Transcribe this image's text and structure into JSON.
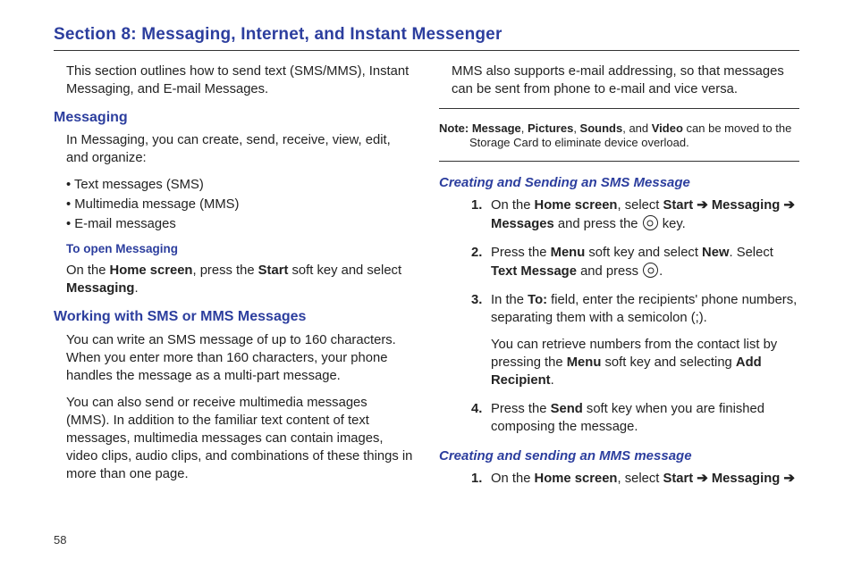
{
  "pageNumber": "58",
  "title": "Section 8: Messaging, Internet, and Instant Messenger",
  "left": {
    "intro": "This section outlines how to send text (SMS/MMS), Instant Messaging, and E-mail Messages.",
    "messaging": {
      "heading": "Messaging",
      "p1": "In Messaging, you can create, send, receive, view, edit, and organize:",
      "bullets": [
        "Text messages (SMS)",
        "Multimedia message (MMS)",
        "E-mail messages"
      ],
      "openHeading": "To open Messaging",
      "open_pre": "On the ",
      "open_b1": "Home screen",
      "open_mid1": ", press the ",
      "open_b2": "Start",
      "open_mid2": " soft key and select ",
      "open_b3": "Messaging",
      "open_post": "."
    },
    "working": {
      "heading": "Working with SMS or MMS Messages",
      "p1": "You can write an SMS message of up to 160 characters. When you enter more than 160 characters, your phone handles the message as a multi-part message.",
      "p2": "You can also send or receive multimedia messages (MMS). In addition to the familiar text content of text messages, multimedia messages can contain images, video clips, audio clips, and combinations of these things in more than one page."
    }
  },
  "right": {
    "mmsIntro": "MMS also supports e-mail addressing, so that messages can be sent from phone to e-mail and vice versa.",
    "note": {
      "label": "Note:",
      "b1": "Message",
      "c1": ", ",
      "b2": "Pictures",
      "c2": ", ",
      "b3": "Sounds",
      "c3": ", and ",
      "b4": "Video",
      "tail": " can be moved to the Storage Card to eliminate device overload."
    },
    "sms": {
      "heading": "Creating and Sending an SMS Message",
      "s1": {
        "n": "1.",
        "a": "On the ",
        "b1": "Home screen",
        "c": ", select ",
        "b2": "Start",
        "arrow1": " ➔ ",
        "b3": "Messaging",
        "arrow2": " ➔ ",
        "b4": "Messages",
        "d": " and press the ",
        "e": " key."
      },
      "s2": {
        "n": "2.",
        "a": "Press the ",
        "b1": "Menu",
        "c": " soft key and select ",
        "b2": "New",
        "d": ". Select ",
        "b3": "Text Message",
        "e": " and press ",
        "f": "."
      },
      "s3": {
        "n": "3.",
        "a": "In the ",
        "b1": "To:",
        "c": " field, enter the recipients' phone numbers, separating them with a semicolon (;).",
        "p2a": "You can retrieve numbers from the contact list by pressing the ",
        "p2b1": "Menu",
        "p2c": " soft key and selecting ",
        "p2b2": "Add Recipient",
        "p2d": "."
      },
      "s4": {
        "n": "4.",
        "a": "Press the ",
        "b1": "Send",
        "c": " soft key when you are finished composing the message."
      }
    },
    "mms": {
      "heading": "Creating and sending an MMS message",
      "s1": {
        "n": "1.",
        "a": "On the ",
        "b1": "Home screen",
        "c": ", select ",
        "b2": "Start",
        "arrow1": " ➔ ",
        "b3": "Messaging",
        "arrow2": " ➔ "
      }
    }
  }
}
